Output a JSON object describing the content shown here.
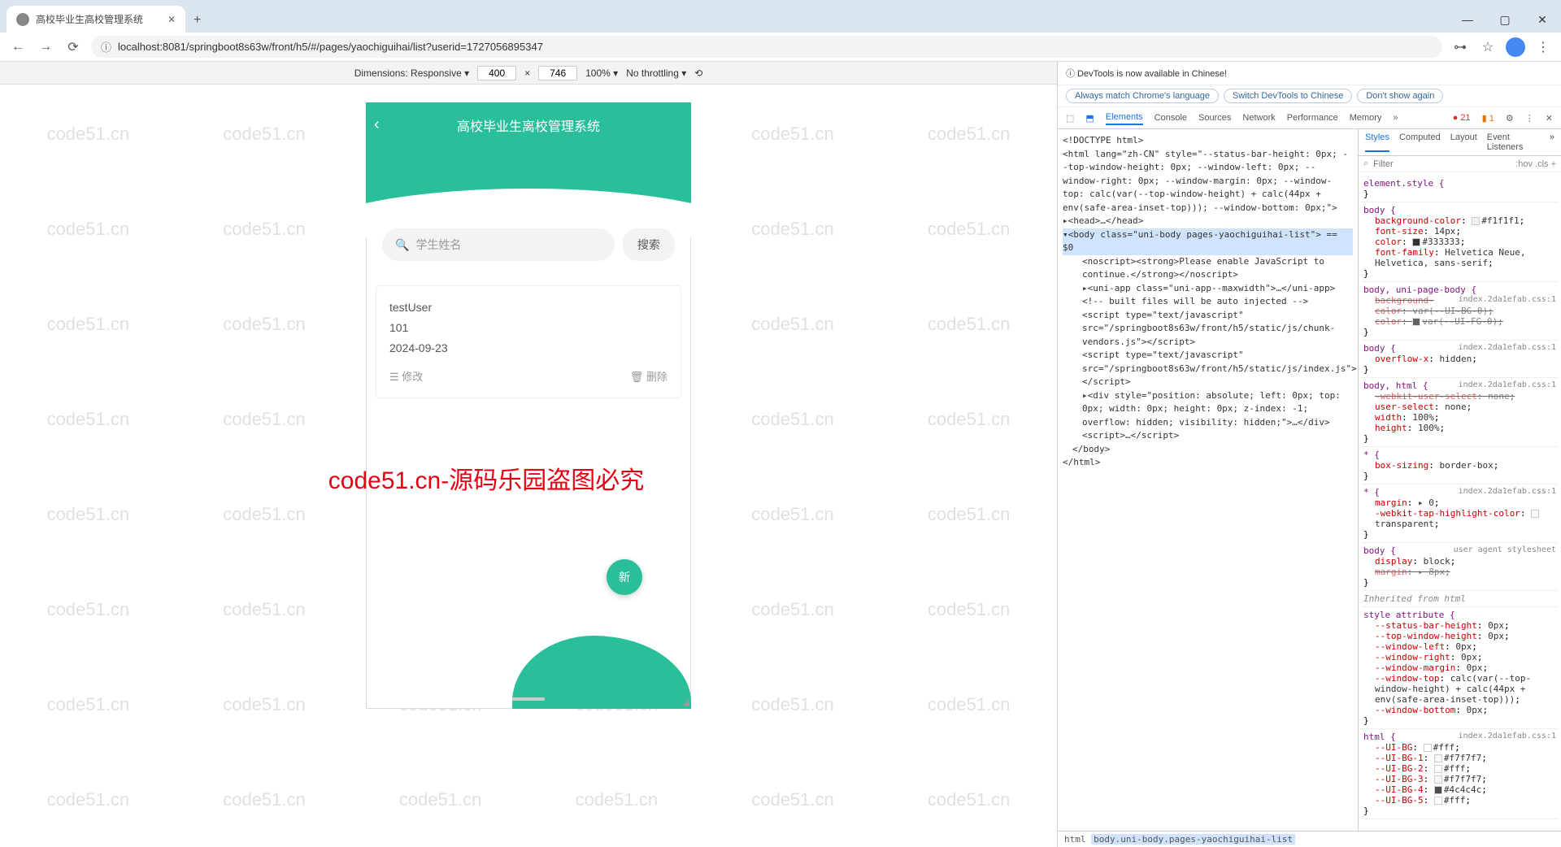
{
  "browser": {
    "tab_title": "高校毕业生高校管理系统",
    "url": "localhost:8081/springboot8s63w/front/h5/#/pages/yaochiguihai/list?userid=1727056895347",
    "new_tab": "+"
  },
  "device_bar": {
    "dimensions_label": "Dimensions: Responsive ▾",
    "width": "400",
    "separator": "×",
    "height": "746",
    "zoom": "100% ▾",
    "throttling": "No throttling ▾"
  },
  "mobile": {
    "title": "高校毕业生离校管理系统",
    "search_placeholder": "学生姓名",
    "search_btn": "搜索",
    "item": {
      "name": "testUser",
      "code": "101",
      "date": "2024-09-23",
      "edit": "☰ 修改",
      "delete": "🗑 删除"
    },
    "fab": "新"
  },
  "watermark": "code51.cn",
  "watermark_red": "code51.cn-源码乐园盗图必究",
  "devtools": {
    "banner": "ⓘ DevTools is now available in Chinese!",
    "pills": {
      "always": "Always match Chrome's language",
      "switch": "Switch DevTools to Chinese",
      "dont": "Don't show again"
    },
    "tabs": {
      "elements": "Elements",
      "console": "Console",
      "sources": "Sources",
      "network": "Network",
      "performance": "Performance",
      "memory": "Memory"
    },
    "errors": "● 21",
    "warnings": "▮ 1",
    "styles_tabs": {
      "styles": "Styles",
      "computed": "Computed",
      "layout": "Layout",
      "listeners": "Event Listeners"
    },
    "filter_placeholder": "Filter",
    "filter_extras": ":hov  .cls  +",
    "breadcrumb_html": "html",
    "breadcrumb_body": "body.uni-body.pages-yaochiguihai-list",
    "elements_lines": [
      "<!DOCTYPE html>",
      "<html lang=\"zh-CN\" style=\"--status-bar-height: 0px; --top-window-height: 0px; --window-left: 0px; --window-right: 0px; --window-margin: 0px; --window-top: calc(var(--top-window-height) + calc(44px + env(safe-area-inset-top))); --window-bottom: 0px;\">",
      "▸<head>…</head>",
      "▾<body class=\"uni-body pages-yaochiguihai-list\"> == $0",
      "  <noscript><strong>Please enable JavaScript to continue.</strong></noscript>",
      "  ▸<uni-app class=\"uni-app--maxwidth\">…</uni-app>",
      "  <!-- built files will be auto injected -->",
      "  <script type=\"text/javascript\" src=\"/springboot8s63w/front/h5/static/js/chunk-vendors.js\"></script>",
      "  <script type=\"text/javascript\" src=\"/springboot8s63w/front/h5/static/js/index.js\"></script>",
      "  ▸<div style=\"position: absolute; left: 0px; top: 0px; width: 0px; height: 0px; z-index: -1; overflow: hidden; visibility: hidden;\">…</div>",
      "  <script>…</script>",
      " </body>",
      "</html>"
    ],
    "rules": [
      {
        "sel": "element.style {",
        "src": "",
        "props": []
      },
      {
        "sel": "body {",
        "src": "<style>",
        "props": [
          {
            "n": "background-color",
            "v": "#f1f1f1",
            "swatch": "#f1f1f1"
          },
          {
            "n": "font-size",
            "v": "14px"
          },
          {
            "n": "color",
            "v": "#333333",
            "swatch": "#333333"
          },
          {
            "n": "font-family",
            "v": "Helvetica Neue, Helvetica, sans-serif"
          }
        ]
      },
      {
        "sel": "body, uni-page-body {",
        "src": "index.2da1efab.css:1",
        "props": [
          {
            "n": "background-color",
            "v": "var(--UI-BG-0)",
            "strike": true
          },
          {
            "n": "color",
            "v": "var(--UI-FG-0)",
            "strike": true,
            "swatch": "#000"
          }
        ]
      },
      {
        "sel": "body {",
        "src": "index.2da1efab.css:1",
        "props": [
          {
            "n": "overflow-x",
            "v": "hidden"
          }
        ]
      },
      {
        "sel": "body, html {",
        "src": "index.2da1efab.css:1",
        "props": [
          {
            "n": "-webkit-user-select",
            "v": "none",
            "strike": true
          },
          {
            "n": "user-select",
            "v": "none"
          },
          {
            "n": "width",
            "v": "100%"
          },
          {
            "n": "height",
            "v": "100%"
          }
        ]
      },
      {
        "sel": "* {",
        "src": "<style>",
        "props": [
          {
            "n": "box-sizing",
            "v": "border-box"
          }
        ]
      },
      {
        "sel": "* {",
        "src": "index.2da1efab.css:1",
        "props": [
          {
            "n": "margin",
            "v": "▸ 0"
          },
          {
            "n": "-webkit-tap-highlight-color",
            "v": "transparent",
            "swatch": "transparent"
          }
        ]
      },
      {
        "sel": "body {",
        "src": "user agent stylesheet",
        "props": [
          {
            "n": "display",
            "v": "block",
            "ua": true
          },
          {
            "n": "margin",
            "v": "▸ 8px",
            "strike": true,
            "ua": true
          }
        ]
      },
      {
        "sel": "Inherited from html",
        "src": "",
        "header": true
      },
      {
        "sel": "style attribute {",
        "src": "",
        "props": [
          {
            "n": "--status-bar-height",
            "v": "0px"
          },
          {
            "n": "--top-window-height",
            "v": "0px"
          },
          {
            "n": "--window-left",
            "v": "0px"
          },
          {
            "n": "--window-right",
            "v": "0px"
          },
          {
            "n": "--window-margin",
            "v": "0px"
          },
          {
            "n": "--window-top",
            "v": "calc(var(--top-window-height) + calc(44px + env(safe-area-inset-top)))"
          },
          {
            "n": "--window-bottom",
            "v": "0px"
          }
        ]
      },
      {
        "sel": "html {",
        "src": "index.2da1efab.css:1",
        "props": [
          {
            "n": "--UI-BG",
            "v": "#fff",
            "swatch": "#fff"
          },
          {
            "n": "--UI-BG-1",
            "v": "#f7f7f7",
            "swatch": "#f7f7f7"
          },
          {
            "n": "--UI-BG-2",
            "v": "#fff",
            "swatch": "#fff"
          },
          {
            "n": "--UI-BG-3",
            "v": "#f7f7f7",
            "swatch": "#f7f7f7"
          },
          {
            "n": "--UI-BG-4",
            "v": "#4c4c4c",
            "swatch": "#4c4c4c"
          },
          {
            "n": "--UI-BG-5",
            "v": "#fff",
            "swatch": "#fff"
          }
        ]
      }
    ]
  }
}
